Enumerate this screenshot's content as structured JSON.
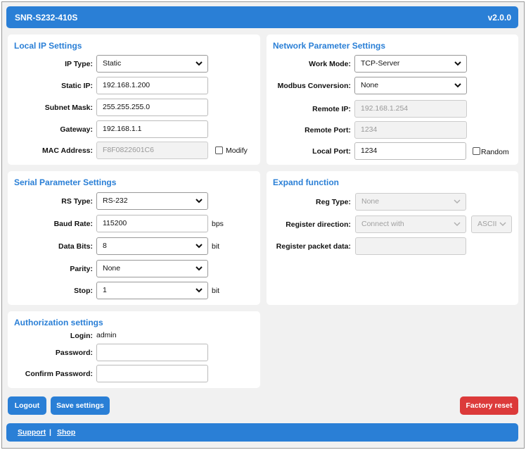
{
  "header": {
    "title": "SNR-S232-410S",
    "version": "v2.0.0"
  },
  "local_ip": {
    "title": "Local IP Settings",
    "ip_type_label": "IP Type:",
    "ip_type_value": "Static",
    "static_ip_label": "Static IP:",
    "static_ip_value": "192.168.1.200",
    "subnet_label": "Subnet Mask:",
    "subnet_value": "255.255.255.0",
    "gateway_label": "Gateway:",
    "gateway_value": "192.168.1.1",
    "mac_label": "MAC Address:",
    "mac_value": "F8F0822601C6",
    "modify_label": "Modify",
    "modify_checked": false
  },
  "network": {
    "title": "Network Parameter Settings",
    "work_mode_label": "Work Mode:",
    "work_mode_value": "TCP-Server",
    "modbus_label": "Modbus Conversion:",
    "modbus_value": "None",
    "remote_ip_label": "Remote IP:",
    "remote_ip_value": "192.168.1.254",
    "remote_port_label": "Remote Port:",
    "remote_port_value": "1234",
    "local_port_label": "Local Port:",
    "local_port_value": "1234",
    "random_label": "Random",
    "random_checked": false
  },
  "serial": {
    "title": "Serial Parameter Settings",
    "rs_type_label": "RS Type:",
    "rs_type_value": "RS-232",
    "baud_label": "Baud Rate:",
    "baud_value": "115200",
    "baud_unit": "bps",
    "data_bits_label": "Data Bits:",
    "data_bits_value": "8",
    "data_bits_unit": "bit",
    "parity_label": "Parity:",
    "parity_value": "None",
    "stop_label": "Stop:",
    "stop_value": "1",
    "stop_unit": "bit"
  },
  "expand": {
    "title": "Expand function",
    "reg_type_label": "Reg Type:",
    "reg_type_value": "None",
    "reg_dir_label": "Register direction:",
    "reg_dir_value": "Connect with",
    "reg_dir_format": "ASCII",
    "reg_packet_label": "Register packet data:",
    "reg_packet_value": ""
  },
  "auth": {
    "title": "Authorization settings",
    "login_label": "Login:",
    "login_value": "admin",
    "password_label": "Password:",
    "password_value": "",
    "confirm_label": "Confirm Password:",
    "confirm_value": ""
  },
  "actions": {
    "logout": "Logout",
    "save": "Save settings",
    "factory_reset": "Factory reset"
  },
  "footer": {
    "support": "Support",
    "separator": "|",
    "shop": "Shop"
  },
  "colors": {
    "accent": "#2a7fd6",
    "danger": "#dc3a3a",
    "background": "#f1f1f1"
  }
}
